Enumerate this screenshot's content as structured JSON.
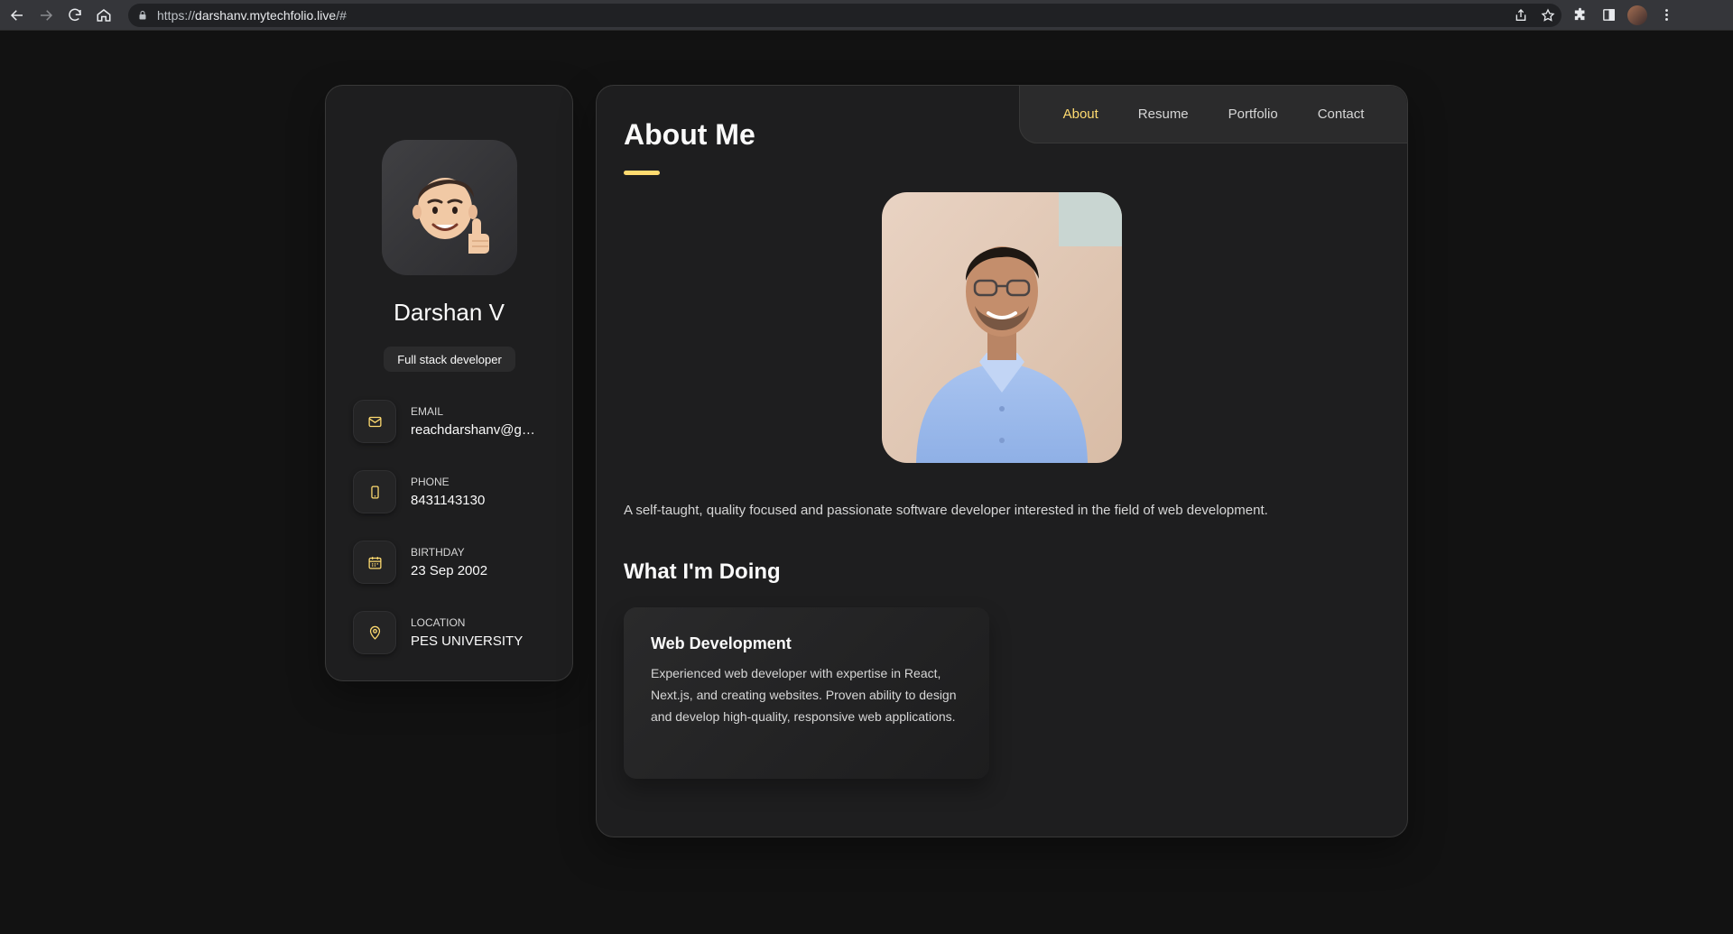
{
  "browser": {
    "url_scheme": "https://",
    "url_host": "darshanv.mytechfolio.live",
    "url_path": "/#"
  },
  "sidebar": {
    "name": "Darshan V",
    "role": "Full stack developer",
    "avatar_icon": "memoji-thumbs-up",
    "contacts": [
      {
        "title": "Email",
        "value": "reachdarshanv@gmail.com",
        "icon": "mail-icon"
      },
      {
        "title": "Phone",
        "value": "8431143130",
        "icon": "phone-icon"
      },
      {
        "title": "Birthday",
        "value": "23 Sep 2002",
        "icon": "calendar-icon"
      },
      {
        "title": "Location",
        "value": "PES UNIVERSITY",
        "icon": "location-pin-icon"
      }
    ]
  },
  "nav": {
    "items": [
      "About",
      "Resume",
      "Portfolio",
      "Contact"
    ],
    "active": "About"
  },
  "about": {
    "title": "About Me",
    "text": "A self-taught, quality focused and passionate software developer interested in the field of web development.",
    "section_title": "What I'm Doing",
    "service": {
      "title": "Web Development",
      "text": "Experienced web developer with expertise in React, Next.js, and creating websites. Proven ability to design and develop high-quality, responsive web applications."
    }
  },
  "colors": {
    "accent": "#ffdb70",
    "background": "#121212",
    "card": "#1e1e1f"
  }
}
